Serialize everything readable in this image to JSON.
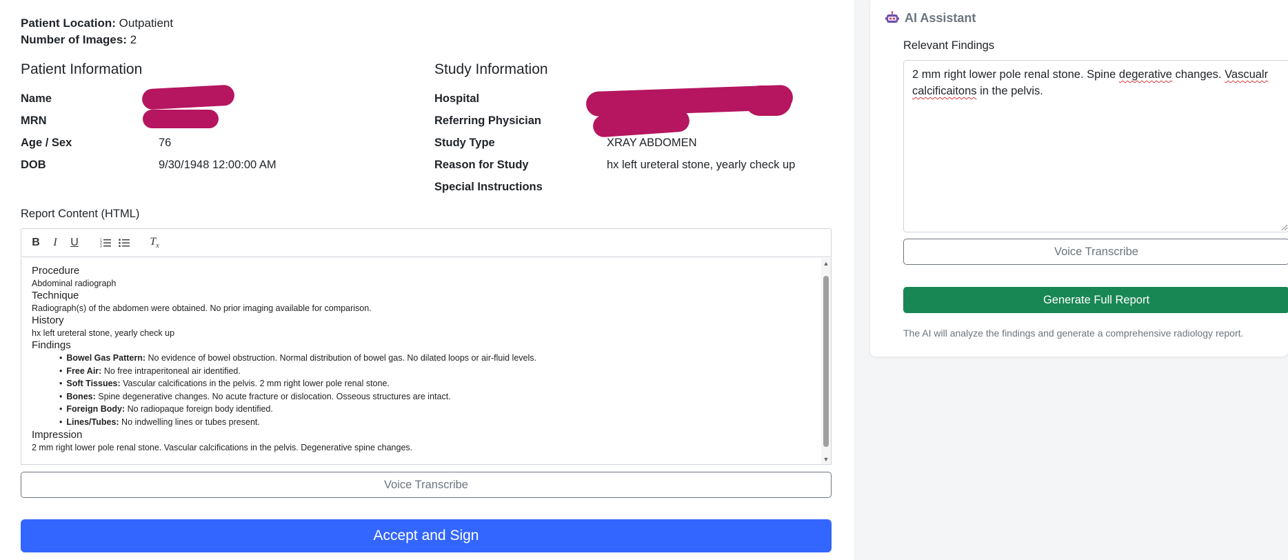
{
  "meta": {
    "location_label": "Patient Location:",
    "location_value": "Outpatient",
    "images_label": "Number of Images:",
    "images_value": "2"
  },
  "patient_info": {
    "title": "Patient Information",
    "fields": [
      {
        "label": "Name",
        "value": ""
      },
      {
        "label": "MRN",
        "value": ""
      },
      {
        "label": "Age / Sex",
        "value": "76"
      },
      {
        "label": "DOB",
        "value": "9/30/1948 12:00:00 AM"
      }
    ]
  },
  "study_info": {
    "title": "Study Information",
    "fields": [
      {
        "label": "Hospital",
        "value": ""
      },
      {
        "label": "Referring Physician",
        "value": ""
      },
      {
        "label": "Study Type",
        "value": "XRAY ABDOMEN"
      },
      {
        "label": "Reason for Study",
        "value": "hx left ureteral stone, yearly check up"
      },
      {
        "label": "Special Instructions",
        "value": ""
      }
    ]
  },
  "report": {
    "label": "Report Content (HTML)",
    "toolbar": {
      "bold": "B",
      "italic": "I",
      "underline": "U",
      "clear": "Tx"
    },
    "sections": {
      "procedure_h": "Procedure",
      "procedure": "Abdominal radiograph",
      "technique_h": "Technique",
      "technique": "Radiograph(s) of the abdomen were obtained. No prior imaging available for comparison.",
      "history_h": "History",
      "history": "hx left ureteral stone, yearly check up",
      "findings_h": "Findings",
      "findings": [
        {
          "label": "Bowel Gas Pattern:",
          "text": "No evidence of bowel obstruction. Normal distribution of bowel gas. No dilated loops or air-fluid levels."
        },
        {
          "label": "Free Air:",
          "text": "No free intraperitoneal air identified."
        },
        {
          "label": "Soft Tissues:",
          "text": "Vascular calcifications in the pelvis. 2 mm right lower pole renal stone."
        },
        {
          "label": "Bones:",
          "text": "Spine degenerative changes. No acute fracture or dislocation. Osseous structures are intact."
        },
        {
          "label": "Foreign Body:",
          "text": "No radiopaque foreign body identified."
        },
        {
          "label": "Lines/Tubes:",
          "text": "No indwelling lines or tubes present."
        }
      ],
      "impression_h": "Impression",
      "impression": "2 mm right lower pole renal stone. Vascular calcifications in the pelvis. Degenerative spine changes."
    },
    "voice_label": "Voice Transcribe",
    "accept_label": "Accept and Sign"
  },
  "assistant": {
    "title": "AI Assistant",
    "icon": "robot-icon",
    "findings_label": "Relevant Findings",
    "findings_parts": {
      "p1": "2 mm right lower pole renal stone. Spine ",
      "w1": "degerative",
      "p2": " changes. ",
      "w2": "Vascualr",
      "p3": " ",
      "w3": "calcificaitons",
      "p4": " in the pelvis."
    },
    "voice_label": "Voice Transcribe",
    "generate_label": "Generate Full Report",
    "help": "The AI will analyze the findings and generate a comprehensive radiology report."
  },
  "colors": {
    "primary": "#3366ff",
    "success": "#198754",
    "redaction": "#b5165f"
  }
}
